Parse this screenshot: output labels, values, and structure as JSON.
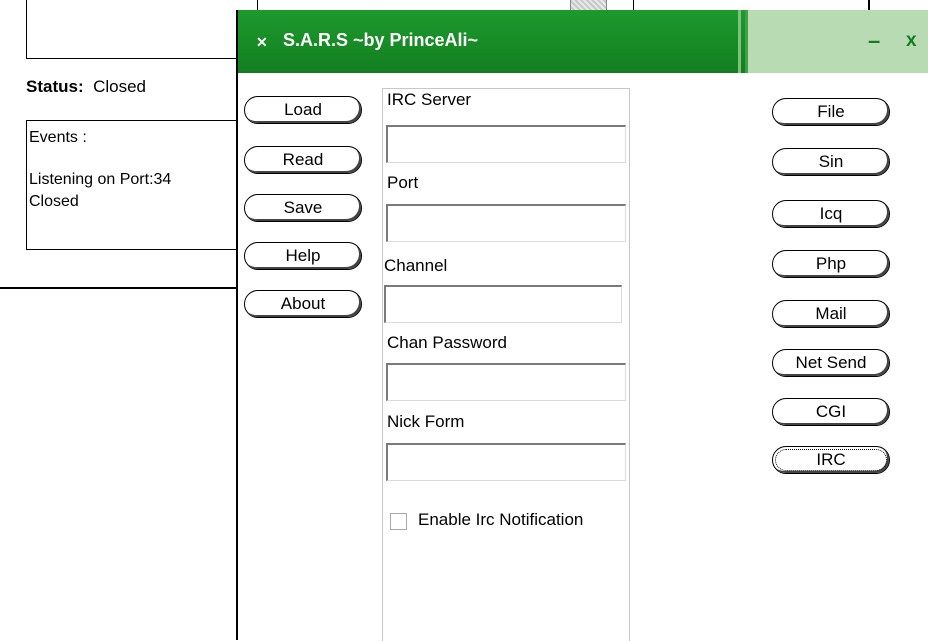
{
  "background_window": {
    "status_label": "Status:",
    "status_value": "Closed",
    "events_title": "Events :",
    "events_lines": [
      "Listening on Port:34",
      "Closed"
    ]
  },
  "app": {
    "title": "S.A.R.S ~by PrinceAli~",
    "icon": "x-logo-icon",
    "minimize_glyph": "–",
    "close_glyph": "x",
    "left_buttons": [
      "Load",
      "Read",
      "Save",
      "Help",
      "About"
    ],
    "right_buttons": [
      "File",
      "Sin",
      "Icq",
      "Php",
      "Mail",
      "Net Send",
      "CGI",
      "IRC"
    ],
    "focused_button": "IRC",
    "fields": {
      "irc_server": {
        "label": "IRC Server",
        "value": ""
      },
      "port": {
        "label": "Port",
        "value": ""
      },
      "channel": {
        "label": "Channel",
        "value": ""
      },
      "chan_password": {
        "label": "Chan Password",
        "value": ""
      },
      "nick_form": {
        "label": "Nick Form",
        "value": ""
      }
    },
    "checkbox": {
      "label": "Enable Irc Notification",
      "checked": false
    },
    "colors": {
      "titlebar": "#1d9a2c",
      "titlebar_right": "#b9dbb4"
    }
  }
}
